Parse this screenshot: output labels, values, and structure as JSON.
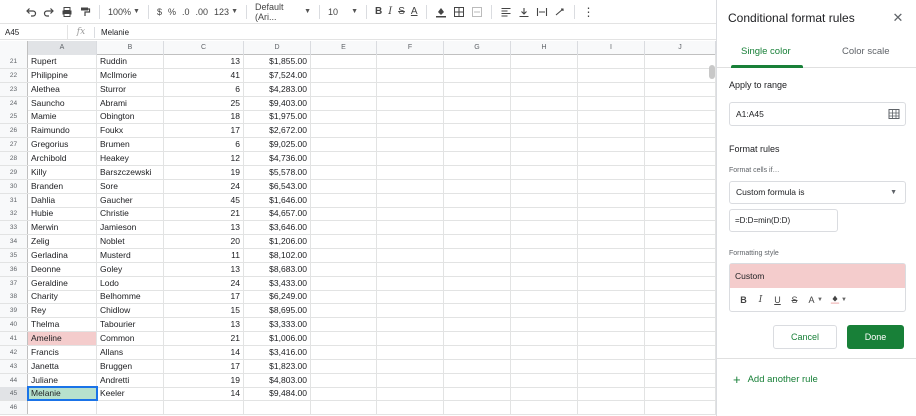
{
  "toolbar": {
    "zoom": "100%",
    "currency": "$",
    "percent": "%",
    "decimal_less": ".0",
    "decimal_more": ".00",
    "format_more": "123",
    "font": "Default (Ari...",
    "font_size": "10"
  },
  "formula_bar": {
    "cell_ref": "A45",
    "fx": "fx",
    "value": "Melanie"
  },
  "columns": [
    "A",
    "B",
    "C",
    "D",
    "E",
    "F",
    "G",
    "H",
    "I",
    "J"
  ],
  "rows": [
    {
      "n": "21",
      "first": "Rupert",
      "last": "Ruddin",
      "qty": "13",
      "amount": "$1,855.00"
    },
    {
      "n": "22",
      "first": "Philippine",
      "last": "McIlmorie",
      "qty": "41",
      "amount": "$7,524.00"
    },
    {
      "n": "23",
      "first": "Alethea",
      "last": "Sturror",
      "qty": "6",
      "amount": "$4,283.00"
    },
    {
      "n": "24",
      "first": "Sauncho",
      "last": "Abrami",
      "qty": "25",
      "amount": "$9,403.00"
    },
    {
      "n": "25",
      "first": "Mamie",
      "last": "Obington",
      "qty": "18",
      "amount": "$1,975.00"
    },
    {
      "n": "26",
      "first": "Raimundo",
      "last": "Foukx",
      "qty": "17",
      "amount": "$2,672.00"
    },
    {
      "n": "27",
      "first": "Gregorius",
      "last": "Brumen",
      "qty": "6",
      "amount": "$9,025.00"
    },
    {
      "n": "28",
      "first": "Archibold",
      "last": "Heakey",
      "qty": "12",
      "amount": "$4,736.00"
    },
    {
      "n": "29",
      "first": "Killy",
      "last": "Barszczewski",
      "qty": "19",
      "amount": "$5,578.00"
    },
    {
      "n": "30",
      "first": "Branden",
      "last": "Sore",
      "qty": "24",
      "amount": "$6,543.00"
    },
    {
      "n": "31",
      "first": "Dahlia",
      "last": "Gaucher",
      "qty": "45",
      "amount": "$1,646.00"
    },
    {
      "n": "32",
      "first": "Hubie",
      "last": "Christie",
      "qty": "21",
      "amount": "$4,657.00"
    },
    {
      "n": "33",
      "first": "Merwin",
      "last": "Jamieson",
      "qty": "13",
      "amount": "$3,646.00"
    },
    {
      "n": "34",
      "first": "Zelig",
      "last": "Noblet",
      "qty": "20",
      "amount": "$1,206.00"
    },
    {
      "n": "35",
      "first": "Gerladina",
      "last": "Musterd",
      "qty": "11",
      "amount": "$8,102.00"
    },
    {
      "n": "36",
      "first": "Deonne",
      "last": "Goley",
      "qty": "13",
      "amount": "$8,683.00"
    },
    {
      "n": "37",
      "first": "Geraldine",
      "last": "Lodo",
      "qty": "24",
      "amount": "$3,433.00"
    },
    {
      "n": "38",
      "first": "Charity",
      "last": "Belhomme",
      "qty": "17",
      "amount": "$6,249.00"
    },
    {
      "n": "39",
      "first": "Rey",
      "last": "Chidlow",
      "qty": "15",
      "amount": "$8,695.00"
    },
    {
      "n": "40",
      "first": "Thelma",
      "last": "Tabourier",
      "qty": "13",
      "amount": "$3,333.00"
    },
    {
      "n": "41",
      "first": "Ameline",
      "last": "Common",
      "qty": "21",
      "amount": "$1,006.00"
    },
    {
      "n": "42",
      "first": "Francis",
      "last": "Allans",
      "qty": "14",
      "amount": "$3,416.00"
    },
    {
      "n": "43",
      "first": "Janetta",
      "last": "Bruggen",
      "qty": "17",
      "amount": "$1,823.00"
    },
    {
      "n": "44",
      "first": "Juliane",
      "last": "Andretti",
      "qty": "19",
      "amount": "$4,803.00"
    },
    {
      "n": "45",
      "first": "Melanie",
      "last": "Keeler",
      "qty": "14",
      "amount": "$9,484.00"
    },
    {
      "n": "46",
      "first": "",
      "last": "",
      "qty": "",
      "amount": ""
    }
  ],
  "highlight_row": "41",
  "active_row": "45",
  "colors": {
    "highlight": "#f4cccc",
    "active": "#b7e1cd",
    "accent": "#188038",
    "selection": "#1a73e8"
  },
  "panel": {
    "title": "Conditional format rules",
    "tabs": [
      "Single color",
      "Color scale"
    ],
    "apply_label": "Apply to range",
    "range": "A1:A45",
    "rules_label": "Format rules",
    "cells_if_label": "Format cells if…",
    "condition": "Custom formula is",
    "formula": "=D:D=min(D:D)",
    "style_label": "Formatting style",
    "style_preview": "Custom",
    "cancel": "Cancel",
    "done": "Done",
    "add_rule": "Add another rule"
  }
}
